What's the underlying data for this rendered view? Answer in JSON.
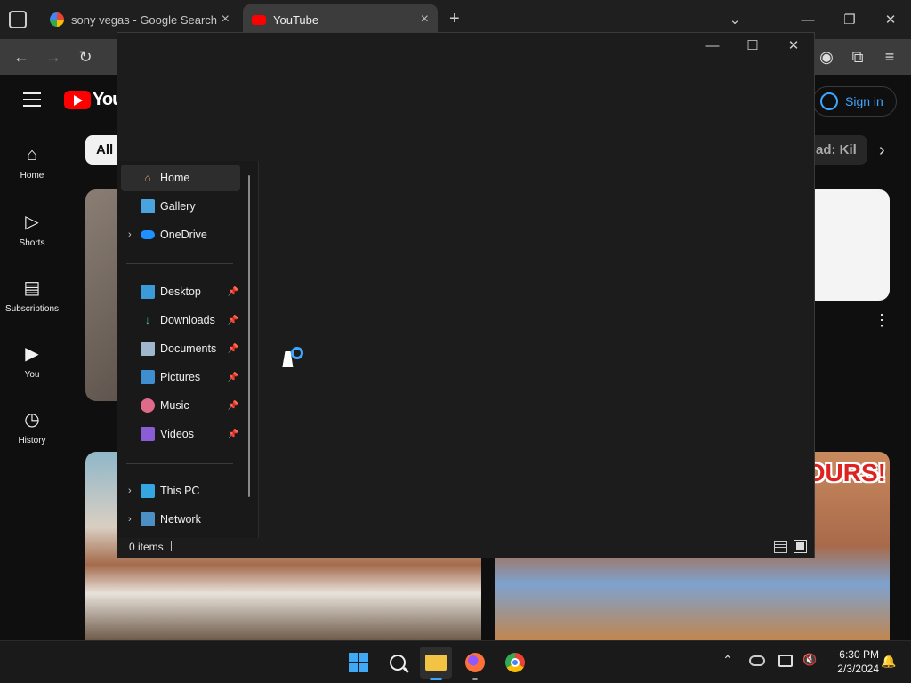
{
  "browser": {
    "tabs": [
      {
        "label": "sony vegas - Google Search"
      },
      {
        "label": "YouTube"
      }
    ]
  },
  "youtube": {
    "brand": "You",
    "sign_in": "Sign in",
    "chips": [
      "All",
      "ad: Kil"
    ],
    "nav": [
      {
        "label": "Home"
      },
      {
        "label": "Shorts"
      },
      {
        "label": "Subscriptions"
      },
      {
        "label": "You"
      },
      {
        "label": "History"
      }
    ],
    "thumb_text": "OURS!"
  },
  "explorer": {
    "nav_items": [
      {
        "label": "Home",
        "icon": "home-icon",
        "selected": true,
        "has_chevron": false,
        "pinned": false
      },
      {
        "label": "Gallery",
        "icon": "gallery-icon",
        "selected": false,
        "has_chevron": false,
        "pinned": false
      },
      {
        "label": "OneDrive",
        "icon": "onedrive-icon",
        "selected": false,
        "has_chevron": true,
        "pinned": false
      },
      {
        "label": "Desktop",
        "icon": "desktop-icon",
        "selected": false,
        "has_chevron": false,
        "pinned": true
      },
      {
        "label": "Downloads",
        "icon": "downloads-icon",
        "selected": false,
        "has_chevron": false,
        "pinned": true
      },
      {
        "label": "Documents",
        "icon": "documents-icon",
        "selected": false,
        "has_chevron": false,
        "pinned": true
      },
      {
        "label": "Pictures",
        "icon": "pictures-icon",
        "selected": false,
        "has_chevron": false,
        "pinned": true
      },
      {
        "label": "Music",
        "icon": "music-icon",
        "selected": false,
        "has_chevron": false,
        "pinned": true
      },
      {
        "label": "Videos",
        "icon": "videos-icon",
        "selected": false,
        "has_chevron": false,
        "pinned": true
      },
      {
        "label": "This PC",
        "icon": "this-pc-icon",
        "selected": false,
        "has_chevron": true,
        "pinned": false
      },
      {
        "label": "Network",
        "icon": "network-icon",
        "selected": false,
        "has_chevron": true,
        "pinned": false
      }
    ],
    "status_text": "0 items"
  },
  "taskbar": {
    "time": "6:30 PM",
    "date": "2/3/2024"
  },
  "colors": {
    "youtube_red": "#ff0000",
    "accent_blue": "#3ea6ff",
    "explorer_bg": "#1c1c1c"
  }
}
